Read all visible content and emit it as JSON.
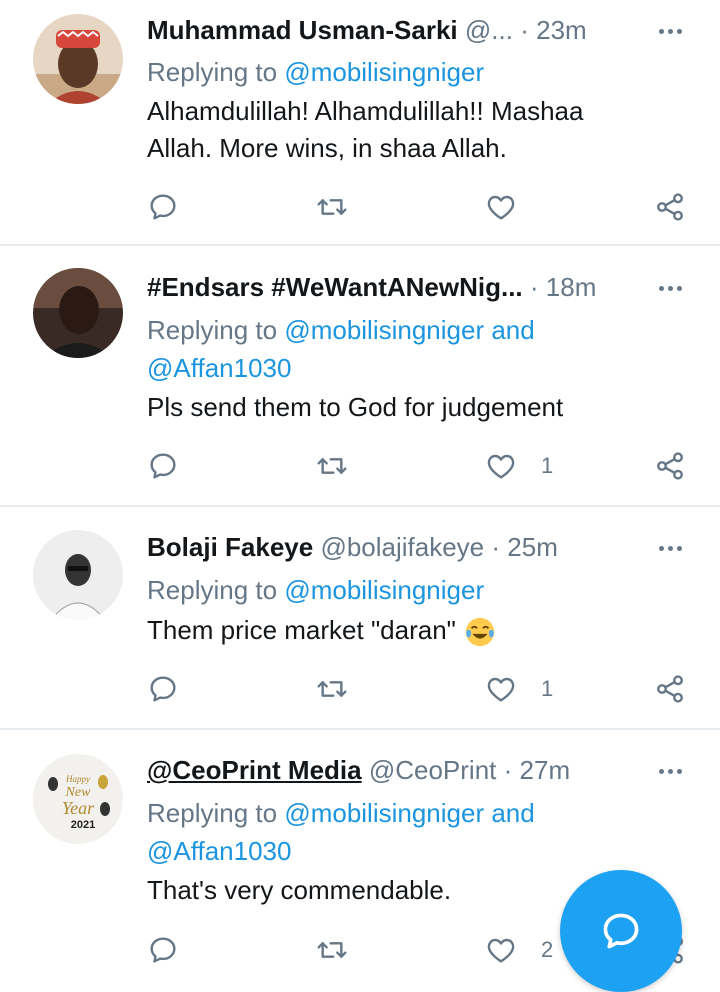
{
  "tweets": [
    {
      "name": "Muhammad Usman-Sarki",
      "handle": "@...",
      "time": "23m",
      "reply_prefix": "Replying to",
      "reply_to": "@mobilisingniger",
      "reply_to_2": "",
      "text": "Alhamdulillah! Alhamdulillah!! Mashaa Allah. More wins, in shaa Allah.",
      "likes": ""
    },
    {
      "name": "#Endsars #WeWantANewNig...",
      "handle": "",
      "time": "18m",
      "reply_prefix": "Replying to",
      "reply_to": "@mobilisingniger and",
      "reply_to_2": "@Affan1030",
      "text": "Pls send them to God for judgement",
      "likes": "1"
    },
    {
      "name": "Bolaji Fakeye",
      "handle": "@bolajifakeye",
      "time": "25m",
      "reply_prefix": "Replying to",
      "reply_to": "@mobilisingniger",
      "reply_to_2": "",
      "text": "Them price market \"daran\"",
      "emoji": "😂",
      "likes": "1"
    },
    {
      "name": "@CeoPrint Media",
      "handle": "@CeoPrint",
      "time": "27m",
      "reply_prefix": "Replying to",
      "reply_to": "@mobilisingniger and",
      "reply_to_2": "@Affan1030",
      "text": "That's very commendable.",
      "likes": "2"
    }
  ],
  "avatar_text": {
    "happy": "Happy",
    "new": "New",
    "year": "Year",
    "yr": "2021"
  },
  "separator": "·",
  "icons": {
    "reply": "reply-icon",
    "retweet": "retweet-icon",
    "like": "heart-icon",
    "share": "share-icon",
    "more": "more-icon",
    "compose": "compose-reply-icon"
  },
  "colors": {
    "accent": "#1da1f2",
    "link": "#1b95e0",
    "muted": "#657786",
    "text": "#14171a",
    "divider": "#e6ecf0"
  }
}
